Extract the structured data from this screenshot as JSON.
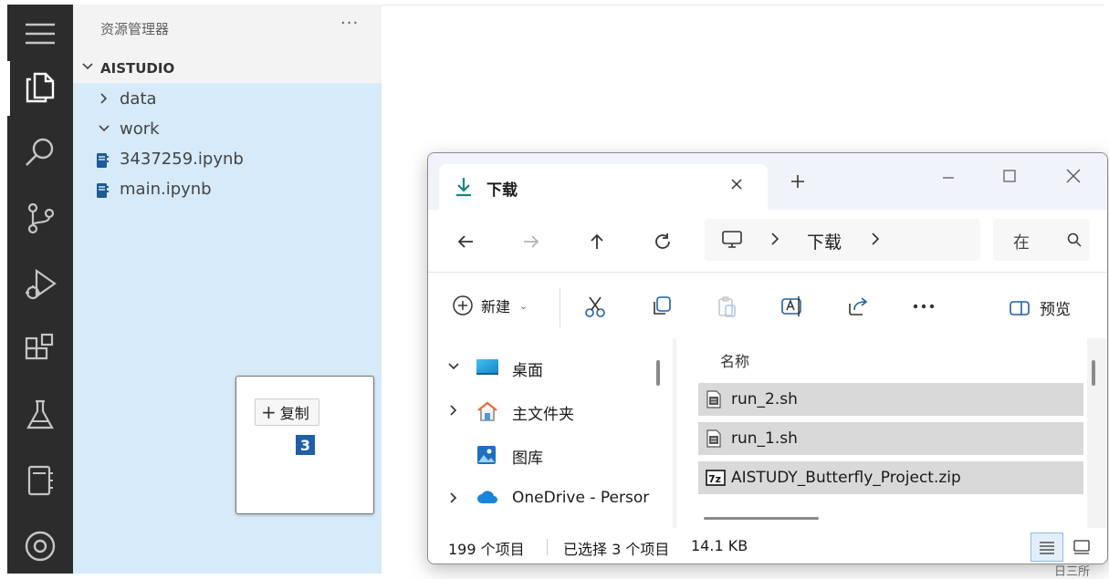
{
  "vscode": {
    "explorer_title": "资源管理器",
    "more_label": "···",
    "workspace_name": "AISTUDIO",
    "tree": [
      {
        "label": "data",
        "kind": "folder",
        "expanded": false
      },
      {
        "label": "work",
        "kind": "folder",
        "expanded": true
      },
      {
        "label": "3437259.ipynb",
        "kind": "notebook"
      },
      {
        "label": "main.ipynb",
        "kind": "notebook"
      }
    ],
    "drag_preview": {
      "action_label": "复制",
      "item_count": "3"
    },
    "status_fragment": "日三所"
  },
  "file_explorer": {
    "tab_title": "下载",
    "address": {
      "crumb": "下载"
    },
    "search_placeholder": "在",
    "toolbar": {
      "new_label": "新建",
      "preview_label": "预览"
    },
    "nav_pane": [
      {
        "label": "桌面",
        "icon": "desktop-icon",
        "expandable": true,
        "expanded": true
      },
      {
        "label": "主文件夹",
        "icon": "home-icon",
        "expandable": true,
        "expanded": false
      },
      {
        "label": "图库",
        "icon": "gallery-icon",
        "expandable": false
      },
      {
        "label": "OneDrive - Persor",
        "icon": "onedrive-icon",
        "expandable": true,
        "expanded": false
      }
    ],
    "column_header": "名称",
    "files": [
      {
        "name": "run_2.sh",
        "icon": "shell-file-icon",
        "selected": true
      },
      {
        "name": "run_1.sh",
        "icon": "shell-file-icon",
        "selected": true
      },
      {
        "name": "AISTUDY_Butterfly_Project.zip",
        "icon": "7z-archive-icon",
        "selected": true
      }
    ],
    "status": {
      "item_count": "199 个项目",
      "selection": "已选择 3 个项目",
      "size": "14.1 KB"
    }
  },
  "colors": {
    "activity_bar": "#2c2c2c",
    "explorer_bg": "#f3f3f3",
    "selection_bg": "#d6eaf9",
    "badge": "#1f5fa8",
    "accent_teal": "#0f8a7a"
  }
}
